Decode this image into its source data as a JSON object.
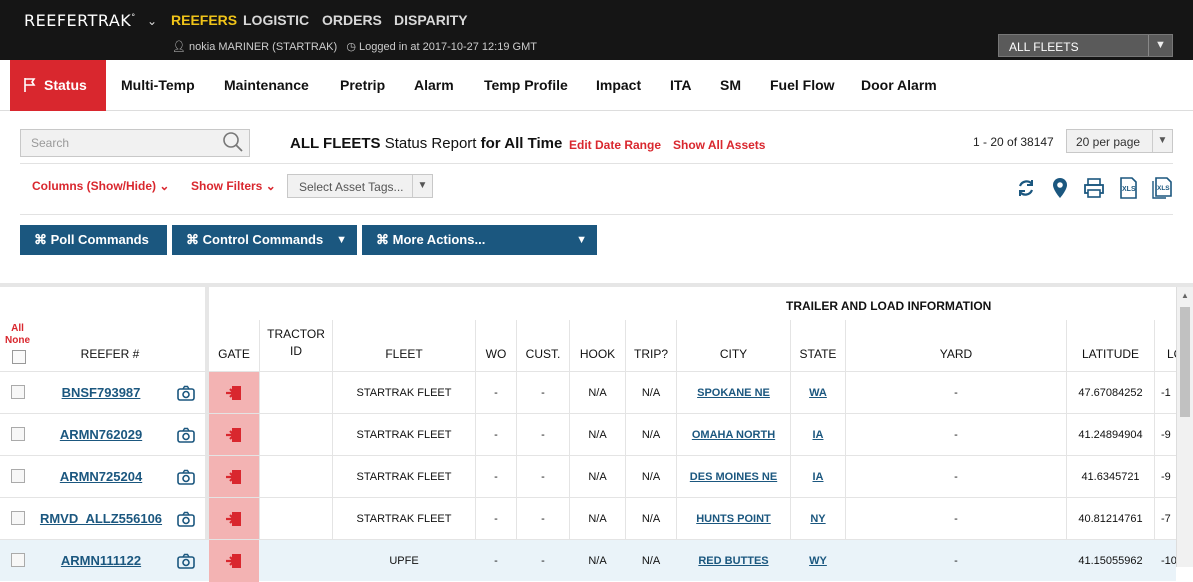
{
  "brand": {
    "name": "REEFERTRAK",
    "mark": "°"
  },
  "topnav": [
    "REEFERS",
    "LOGISTIC",
    "ORDERS",
    "DISPARITY"
  ],
  "user": {
    "name": "nokia MARINER (STARTRAK)",
    "login": "Logged in at 2017-10-27 12:19 GMT"
  },
  "fleet_select": "ALL FLEETS",
  "tabs": [
    "Status",
    "Multi-Temp",
    "Maintenance",
    "Pretrip",
    "Alarm",
    "Temp Profile",
    "Impact",
    "ITA",
    "SM",
    "Fuel Flow",
    "Door Alarm"
  ],
  "search": {
    "placeholder": "Search"
  },
  "report": {
    "fleet": "ALL FLEETS",
    "middle": " Status Report ",
    "range": "for All Time",
    "edit_date": "Edit Date Range",
    "show_all": "Show All Assets"
  },
  "pagination": {
    "count": "1 - 20 of 38147",
    "per_page": "20 per page"
  },
  "filters": {
    "columns": "Columns (Show/Hide)",
    "show_filters": "Show Filters",
    "asset_tags": "Select Asset Tags..."
  },
  "actions": {
    "poll": "⌘ Poll Commands",
    "control": "⌘ Control Commands",
    "more": "⌘ More Actions..."
  },
  "table": {
    "group_header": "TRAILER AND LOAD INFORMATION",
    "all": "All",
    "none": "None",
    "columns": {
      "reefer": "REEFER #",
      "gate": "GATE",
      "tractor": "TRACTOR ID",
      "fleet": "FLEET",
      "wo": "WO",
      "cust": "CUST.",
      "hook": "HOOK",
      "trip": "TRIP?",
      "city": "CITY",
      "state": "STATE",
      "yard": "YARD",
      "latitude": "LATITUDE",
      "longitude": "LO"
    },
    "rows": [
      {
        "reefer": "BNSF793987",
        "fleet": "STARTRAK FLEET",
        "wo": "-",
        "cust": "-",
        "hook": "N/A",
        "trip": "N/A",
        "city": "SPOKANE NE",
        "state": "WA",
        "yard": "-",
        "latitude": "47.67084252",
        "longitude": "-1"
      },
      {
        "reefer": "ARMN762029",
        "fleet": "STARTRAK FLEET",
        "wo": "-",
        "cust": "-",
        "hook": "N/A",
        "trip": "N/A",
        "city": "OMAHA NORTH",
        "state": "IA",
        "yard": "-",
        "latitude": "41.24894904",
        "longitude": "-9"
      },
      {
        "reefer": "ARMN725204",
        "fleet": "STARTRAK FLEET",
        "wo": "-",
        "cust": "-",
        "hook": "N/A",
        "trip": "N/A",
        "city": "DES MOINES NE",
        "state": "IA",
        "yard": "-",
        "latitude": "41.6345721",
        "longitude": "-9"
      },
      {
        "reefer": "RMVD_ALLZ556106",
        "fleet": "STARTRAK FLEET",
        "wo": "-",
        "cust": "-",
        "hook": "N/A",
        "trip": "N/A",
        "city": "HUNTS POINT",
        "state": "NY",
        "yard": "-",
        "latitude": "40.81214761",
        "longitude": "-7"
      },
      {
        "reefer": "ARMN111122",
        "fleet": "UPFE",
        "wo": "-",
        "cust": "-",
        "hook": "N/A",
        "trip": "N/A",
        "city": "RED BUTTES",
        "state": "WY",
        "yard": "-",
        "latitude": "41.15055962",
        "longitude": "-10"
      }
    ]
  },
  "colors": {
    "accent_red": "#d9272e",
    "brand_blue": "#1b577f",
    "active_nav": "#f0c419",
    "gate_bg": "#f3b3b3"
  }
}
